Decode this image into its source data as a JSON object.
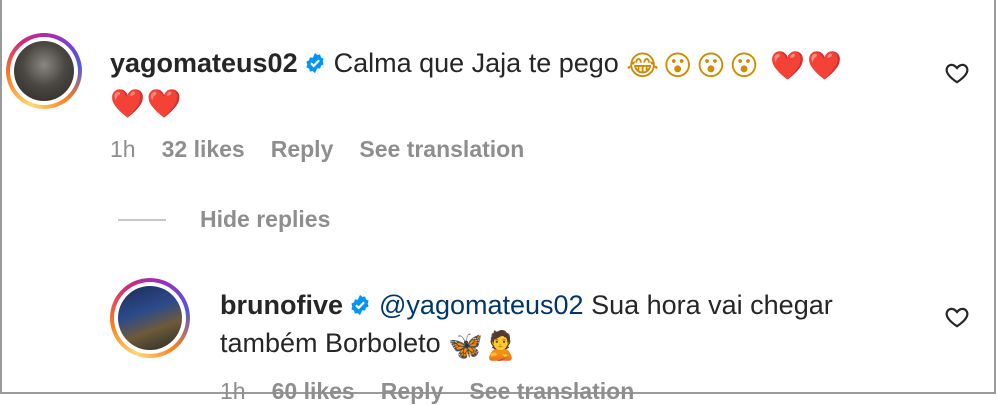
{
  "comment": {
    "username": "yagomateus02",
    "text": "Calma que Jaja te pego",
    "emoji_faces": "😂😮😮😮",
    "emoji_hearts_line1": "❤️❤️",
    "emoji_hearts_line2": "❤️❤️",
    "time": "1h",
    "likes": "32 likes",
    "reply": "Reply",
    "see_translation": "See translation",
    "like_icon": "heart-outline-icon"
  },
  "thread": {
    "hide_replies": "Hide replies"
  },
  "reply": {
    "username": "brunofive",
    "mention": "@yagomateus02",
    "text_line1": "Sua hora vai chegar",
    "text_line2": "também Borboleto",
    "emojis": "🦋🙎",
    "time": "1h",
    "likes": "60 likes",
    "reply": "Reply",
    "see_translation": "See translation",
    "like_icon": "heart-outline-icon"
  },
  "colors": {
    "verified": "#0095f6",
    "meta_text": "#8e8e8e",
    "mention": "#00376b"
  }
}
